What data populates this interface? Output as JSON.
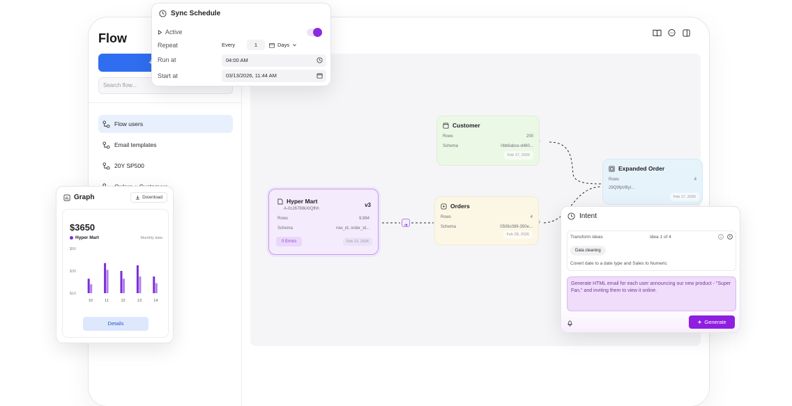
{
  "app": {
    "logo": "Flow",
    "new_button_label": "+",
    "search_placeholder": "Search flow..."
  },
  "sidebar": {
    "items": [
      {
        "label": "Flow users",
        "active": true
      },
      {
        "label": "Email templates",
        "active": false
      },
      {
        "label": "20Y SP500",
        "active": false
      },
      {
        "label": "Orders + Customers",
        "active": false
      }
    ]
  },
  "top_icons": [
    "book-icon",
    "chat-bubble-icon",
    "panel-toggle-icon"
  ],
  "sync_schedule": {
    "title": "Sync Schedule",
    "active_label": "Active",
    "active": true,
    "repeat_label": "Repeat",
    "every_label": "Every",
    "every_value": "1",
    "unit": "Days",
    "run_at_label": "Run at",
    "run_at_value": "04:00 AM",
    "start_at_label": "Start at",
    "start_at_value": "03/13/2026, 11:44 AM"
  },
  "nodes": {
    "customer": {
      "title": "Customer",
      "rows_label": "Rows",
      "rows_value": "200",
      "schema_label": "Schema",
      "schema_value": "0bb6abce-d480...",
      "date": "Feb 17, 2026"
    },
    "orders": {
      "title": "Orders",
      "rows_label": "Rows",
      "rows_value": "4",
      "schema_label": "Schema",
      "schema_value": "0508c089-350e...",
      "date": "Feb 28, 2026"
    },
    "expanded_order": {
      "title": "Expanded Order",
      "rows_label": "Rows",
      "rows_value": "4",
      "schema_value": "29Q9fpVByl...",
      "date": "Feb 17, 2026"
    },
    "hyper_mart": {
      "title": "Hyper Mart",
      "id": "A-0c26769kXtQfhh",
      "version": "v3",
      "rows_label": "Rows",
      "rows_value": "9,984",
      "schema_label": "Schema",
      "schema_value": "row_id, order_id...",
      "errors": "0 Errors",
      "date": "Feb 13, 2026"
    }
  },
  "graph": {
    "title": "Graph",
    "download_label": "Download",
    "amount": "$3650",
    "series_name": "Hyper Mart",
    "period_label": "Monthly data",
    "details_label": "Details"
  },
  "chart_data": {
    "type": "bar",
    "categories": [
      "10",
      "11",
      "12",
      "13",
      "14"
    ],
    "y_ticks": [
      "$50",
      "$30",
      "$10"
    ],
    "ylim": [
      10,
      50
    ],
    "series": [
      {
        "name": "Hyper Mart",
        "values": [
          23,
          37,
          30,
          35,
          25
        ],
        "color": "#7b2fd4"
      },
      {
        "values": [
          18,
          31,
          23,
          25,
          19
        ],
        "color": "#b27ef0"
      }
    ]
  },
  "intent": {
    "title": "Intent",
    "transform_label": "Transform ideas",
    "idea_counter": "Idea 1 of 4",
    "tag": "Data cleaning",
    "description": "Covert date to a date type and Sales to Numeric",
    "prompt": "Generate HTML email for each user announcing our new product - \"Super Fan,\" and inviting them to view it online.",
    "generate_label": "Generate"
  },
  "colors": {
    "accent": "#8e1ee0",
    "primary_blue": "#2f6ef0",
    "customer_bg": "#ecf8e6",
    "orders_bg": "#fbf7e4",
    "expanded_bg": "#e6f3fb",
    "hyper_bg": "#f4ecfc"
  }
}
